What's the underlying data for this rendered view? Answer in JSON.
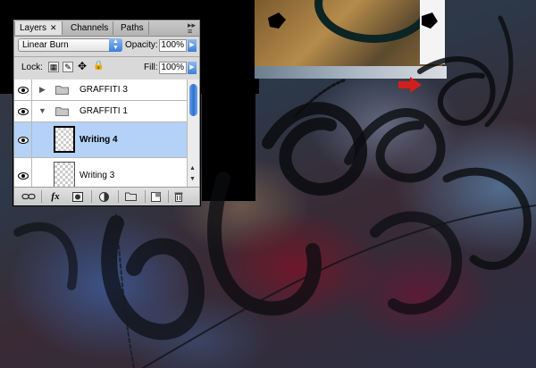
{
  "panel": {
    "tabs": [
      {
        "label": "Layers",
        "close": "✕"
      },
      {
        "label": "Channels"
      },
      {
        "label": "Paths"
      }
    ],
    "blend_mode": "Linear Burn",
    "opacity_label": "Opacity:",
    "opacity_value": "100%",
    "lock_label": "Lock:",
    "fill_label": "Fill:",
    "fill_value": "100%",
    "layers": [
      {
        "name": "GRAFFITI 3",
        "type": "group",
        "expanded": false,
        "visible": true
      },
      {
        "name": "GRAFFITI 1",
        "type": "group",
        "expanded": true,
        "visible": true
      },
      {
        "name": "Writing 4",
        "type": "layer",
        "selected": true,
        "visible": true
      },
      {
        "name": "Writing 3",
        "type": "layer",
        "selected": false,
        "visible": true
      }
    ],
    "footer_icons": [
      "link-icon",
      "fx-icon",
      "mask-icon",
      "adjustment-icon",
      "folder-icon",
      "new-layer-icon",
      "trash-icon"
    ],
    "fx_label": "fx"
  },
  "colors": {
    "selection": "#b4d2f7",
    "accent_blue": "#3d7fd9",
    "arrow_red": "#d0201c"
  }
}
